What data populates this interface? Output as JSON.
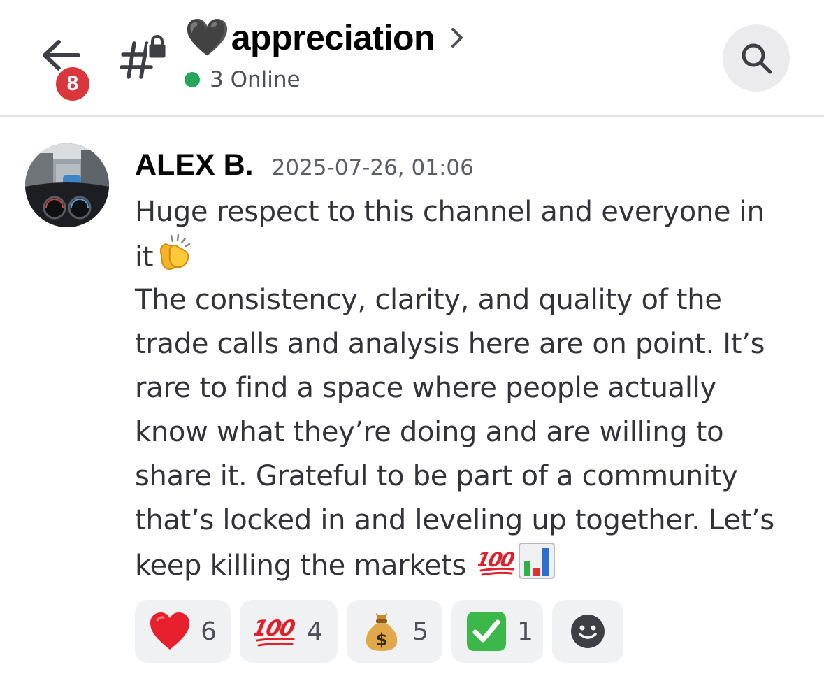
{
  "header": {
    "back_badge_count": "8",
    "channel_title_emoji": "🖤",
    "channel_name": "appreciation",
    "online_status": "3 Online",
    "icons": [
      "back-arrow-icon",
      "locked-channel-icon",
      "chevron-right-icon",
      "search-icon"
    ]
  },
  "message": {
    "author": "ALEX B.",
    "timestamp": "2025-07-26, 01:06",
    "lines": [
      "Huge respect to this channel and everyone in",
      "it",
      "The consistency, clarity, and quality of the",
      "trade calls and analysis here are on point. It’s",
      "rare to find a space where people actually",
      "know what they’re doing and are willing to",
      "share it. Grateful to be part of a community",
      "that’s locked in and leveling up together. Let’s",
      "keep killing the markets"
    ],
    "inline_emojis": [
      "clapping-hands",
      "hundred-points",
      "bar-chart"
    ]
  },
  "reactions": [
    {
      "emoji": "red-heart",
      "count": "6"
    },
    {
      "emoji": "hundred-points",
      "count": "4"
    },
    {
      "emoji": "money-bag",
      "count": "5"
    },
    {
      "emoji": "check-mark-button",
      "count": "1"
    }
  ],
  "colors": {
    "badge": "#da373c",
    "online": "#23a55a",
    "reaction_bg": "#f0f1f3",
    "text": "#313338"
  }
}
